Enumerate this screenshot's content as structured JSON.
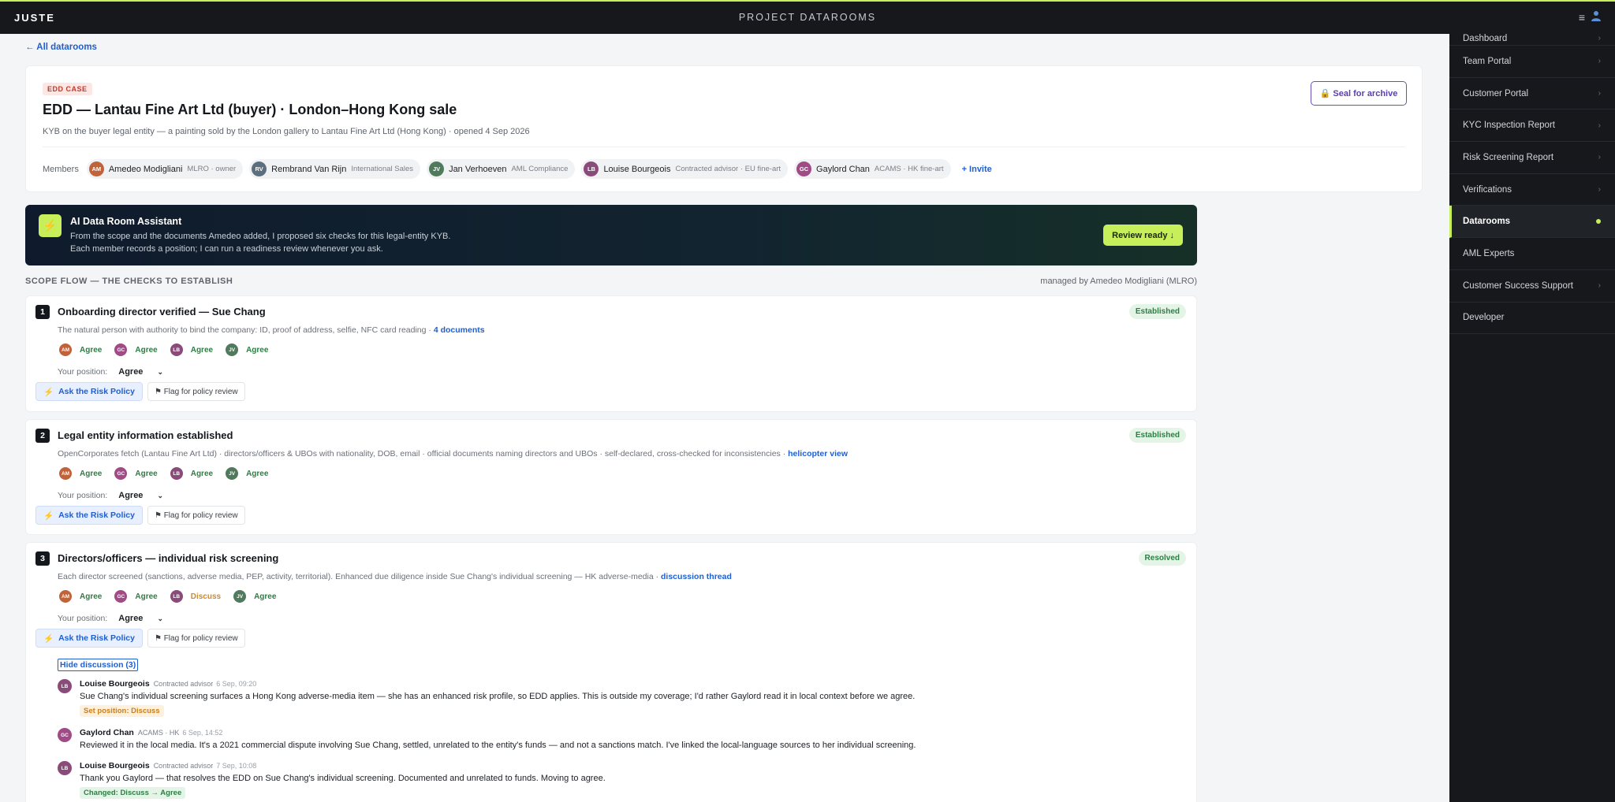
{
  "app": {
    "brand": "JUSTE",
    "title": "PROJECT DATAROOMS",
    "menu_icon": "≡"
  },
  "colors": {
    "accent": "#c6ef5a",
    "link": "#1f5fd0",
    "established": "#2e7d43",
    "discuss": "#d0892a",
    "seal": "#5b3fb0"
  },
  "sidebar": {
    "items": [
      {
        "label": "Dashboard",
        "chevron": "›"
      },
      {
        "label": "Team Portal",
        "chevron": "›"
      },
      {
        "label": "Customer Portal",
        "chevron": "›"
      },
      {
        "label": "KYC Inspection Report",
        "chevron": "›"
      },
      {
        "label": "Risk Screening Report",
        "chevron": "›"
      },
      {
        "label": "Verifications",
        "chevron": "›"
      },
      {
        "label": "Datarooms",
        "active": true
      },
      {
        "label": "AML Experts"
      },
      {
        "label": "Customer Success Support",
        "chevron": "›"
      },
      {
        "label": "Developer"
      }
    ]
  },
  "back_link": "← All datarooms",
  "case": {
    "badge": "EDD CASE",
    "title": "EDD — Lantau Fine Art Ltd (buyer) · London–Hong Kong sale",
    "subtitle": "KYB on the buyer legal entity — a painting sold by the London gallery to Lantau Fine Art Ltd (Hong Kong) · opened 4 Sep 2026",
    "seal_label": "🔒 Seal for archive",
    "members_label": "Members",
    "members": [
      {
        "initials": "AM",
        "name": "Amedeo Modigliani",
        "role": "MLRO · owner",
        "color": "#c0623a"
      },
      {
        "initials": "RV",
        "name": "Rembrand Van Rijn",
        "role": "International Sales",
        "color": "#5b6f7e"
      },
      {
        "initials": "JV",
        "name": "Jan Verhoeven",
        "role": "AML Compliance",
        "color": "#4f7a5c"
      },
      {
        "initials": "LB",
        "name": "Louise Bourgeois",
        "role": "Contracted advisor · EU fine-art",
        "color": "#8a4a7a"
      },
      {
        "initials": "GC",
        "name": "Gaylord Chan",
        "role": "ACAMS · HK fine-art",
        "color": "#a04a86"
      }
    ],
    "invite_label": "+ Invite"
  },
  "assistant": {
    "icon": "⚡",
    "title": "AI Data Room Assistant",
    "text": "From the scope and the documents Amedeo added, I proposed six checks for this legal-entity KYB. Each member records a position; I can run a readiness review whenever you ask.",
    "button": "Review ready ↓"
  },
  "flow": {
    "title": "SCOPE FLOW — THE CHECKS TO ESTABLISH",
    "manager": "managed by Amedeo Modigliani (MLRO)",
    "position_label": "Your position:",
    "ask_label": "Ask the Risk Policy",
    "ask_icon": "⚡",
    "flag_label": "⚑ Flag for policy review"
  },
  "checks": [
    {
      "num": "1",
      "title": "Onboarding director verified — Sue Chang",
      "status": "Established",
      "desc": "The natural person with authority to bind the company: ID, proof of address, selfie, NFC card reading · ",
      "link": "4 documents",
      "votes": [
        {
          "initials": "AM",
          "label": "Agree",
          "color": "#c0623a"
        },
        {
          "initials": "GC",
          "label": "Agree",
          "color": "#a04a86"
        },
        {
          "initials": "LB",
          "label": "Agree",
          "color": "#8a4a7a"
        },
        {
          "initials": "JV",
          "label": "Agree",
          "color": "#4f7a5c"
        }
      ],
      "position": "Agree"
    },
    {
      "num": "2",
      "title": "Legal entity information established",
      "status": "Established",
      "desc": "OpenCorporates fetch (Lantau Fine Art Ltd) · directors/officers & UBOs with nationality, DOB, email · official documents naming directors and UBOs · self-declared, cross-checked for inconsistencies · ",
      "link": "helicopter view",
      "votes": [
        {
          "initials": "AM",
          "label": "Agree",
          "color": "#c0623a"
        },
        {
          "initials": "GC",
          "label": "Agree",
          "color": "#a04a86"
        },
        {
          "initials": "LB",
          "label": "Agree",
          "color": "#8a4a7a"
        },
        {
          "initials": "JV",
          "label": "Agree",
          "color": "#4f7a5c"
        }
      ],
      "position": "Agree"
    },
    {
      "num": "3",
      "title": "Directors/officers — individual risk screening",
      "status": "Resolved",
      "desc": "Each director screened (sanctions, adverse media, PEP, activity, territorial). Enhanced due diligence inside Sue Chang's individual screening — HK adverse-media · ",
      "link": "discussion thread",
      "votes": [
        {
          "initials": "AM",
          "label": "Agree",
          "color": "#c0623a"
        },
        {
          "initials": "GC",
          "label": "Agree",
          "color": "#a04a86"
        },
        {
          "initials": "LB",
          "label": "Discuss",
          "color": "#8a4a7a"
        },
        {
          "initials": "JV",
          "label": "Agree",
          "color": "#4f7a5c"
        }
      ],
      "position": "Agree",
      "hide_discussion": "Hide discussion (3)",
      "comments": [
        {
          "initials": "LB",
          "color": "#8a4a7a",
          "author": "Louise Bourgeois",
          "role": "Contracted advisor",
          "time": "6 Sep, 09:20",
          "text": "Sue Chang's individual screening surfaces a Hong Kong adverse-media item — she has an enhanced risk profile, so EDD applies. This is outside my coverage; I'd rather Gaylord read it in local context before we agree.",
          "tag": "Set position: Discuss"
        },
        {
          "initials": "GC",
          "color": "#a04a86",
          "author": "Gaylord Chan",
          "role": "ACAMS · HK",
          "time": "6 Sep, 14:52",
          "text": "Reviewed it in the local media. It's a 2021 commercial dispute involving Sue Chang, settled, unrelated to the entity's funds — and not a sanctions match. I've linked the local-language sources to her individual screening."
        },
        {
          "initials": "LB",
          "color": "#8a4a7a",
          "author": "Louise Bourgeois",
          "role": "Contracted advisor",
          "time": "7 Sep, 10:08",
          "text": "Thank you Gaylord — that resolves the EDD on Sue Chang's individual screening. Documented and unrelated to funds. Moving to agree.",
          "tag": "Changed: Discuss → Agree"
        }
      ]
    }
  ]
}
